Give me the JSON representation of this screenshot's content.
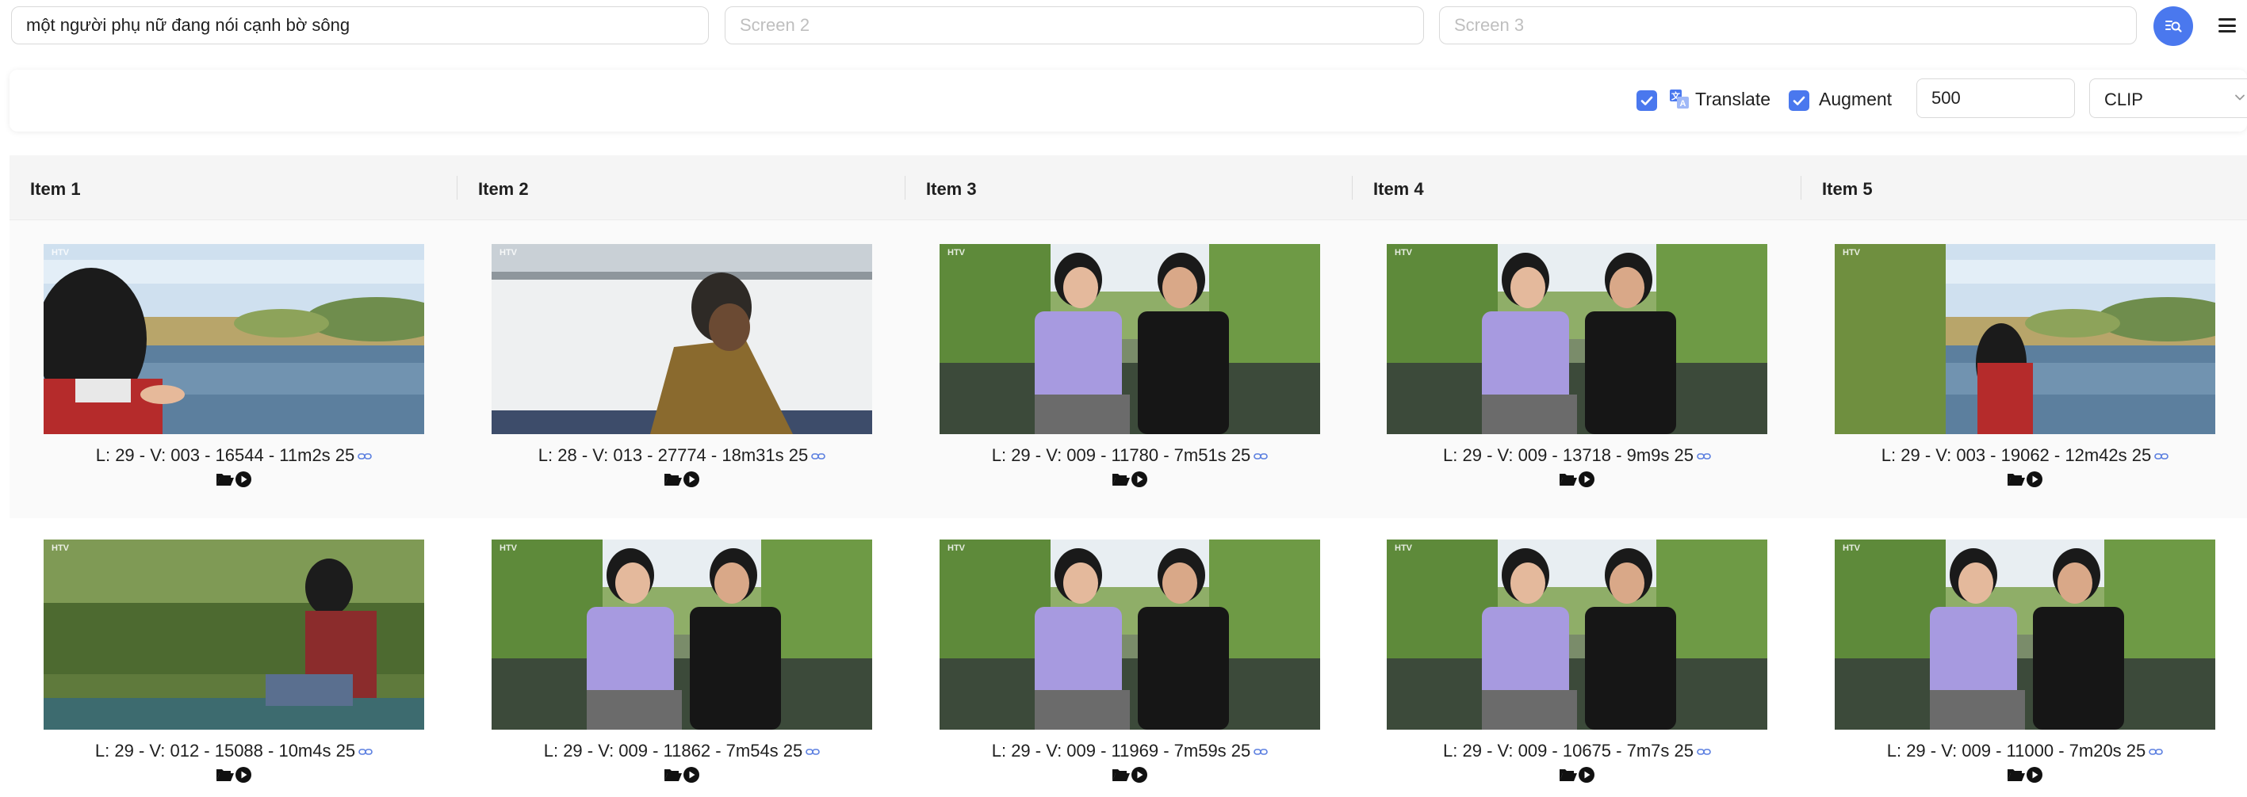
{
  "search": {
    "query1_value": "một người phụ nữ đang nói cạnh bờ sông",
    "query2_placeholder": "Screen 2",
    "query3_placeholder": "Screen 3"
  },
  "options": {
    "translate_label": "Translate",
    "translate_checked": true,
    "augment_label": "Augment",
    "augment_checked": true,
    "top_k_value": "500",
    "model_selected": "CLIP"
  },
  "columns": [
    "Item 1",
    "Item 2",
    "Item 3",
    "Item 4",
    "Item 5"
  ],
  "results": [
    [
      {
        "caption": "L: 29 - V: 003 - 16544 - 11m2s 25",
        "scene": "woman-profile-river"
      },
      {
        "caption": "L: 28 - V: 013 - 27774 - 18m31s 25",
        "scene": "woman-sitting-shore"
      },
      {
        "caption": "L: 29 - V: 009 - 11780 - 7m51s 25",
        "scene": "two-women-boat"
      },
      {
        "caption": "L: 29 - V: 009 - 13718 - 9m9s 25",
        "scene": "two-women-boat"
      },
      {
        "caption": "L: 29 - V: 003 - 19062 - 12m42s 25",
        "scene": "woman-back-river"
      }
    ],
    [
      {
        "caption": "L: 29 - V: 012 - 15088 - 10m4s 25",
        "scene": "woman-boat-bushes"
      },
      {
        "caption": "L: 29 - V: 009 - 11862 - 7m54s 25",
        "scene": "two-women-boat"
      },
      {
        "caption": "L: 29 - V: 009 - 11969 - 7m59s 25",
        "scene": "two-women-boat"
      },
      {
        "caption": "L: 29 - V: 009 - 10675 - 7m7s 25",
        "scene": "two-women-boat"
      },
      {
        "caption": "L: 29 - V: 009 - 11000 - 7m20s 25",
        "scene": "two-women-boat"
      }
    ]
  ],
  "icons": {
    "search_button": "search-list-icon",
    "menu": "hamburger-menu-icon",
    "translate": "translate-icon",
    "caption_link": "link-icon",
    "open_folder": "folder-open-icon",
    "play": "play-circle-icon"
  },
  "colors": {
    "accent": "#4a78ee"
  }
}
